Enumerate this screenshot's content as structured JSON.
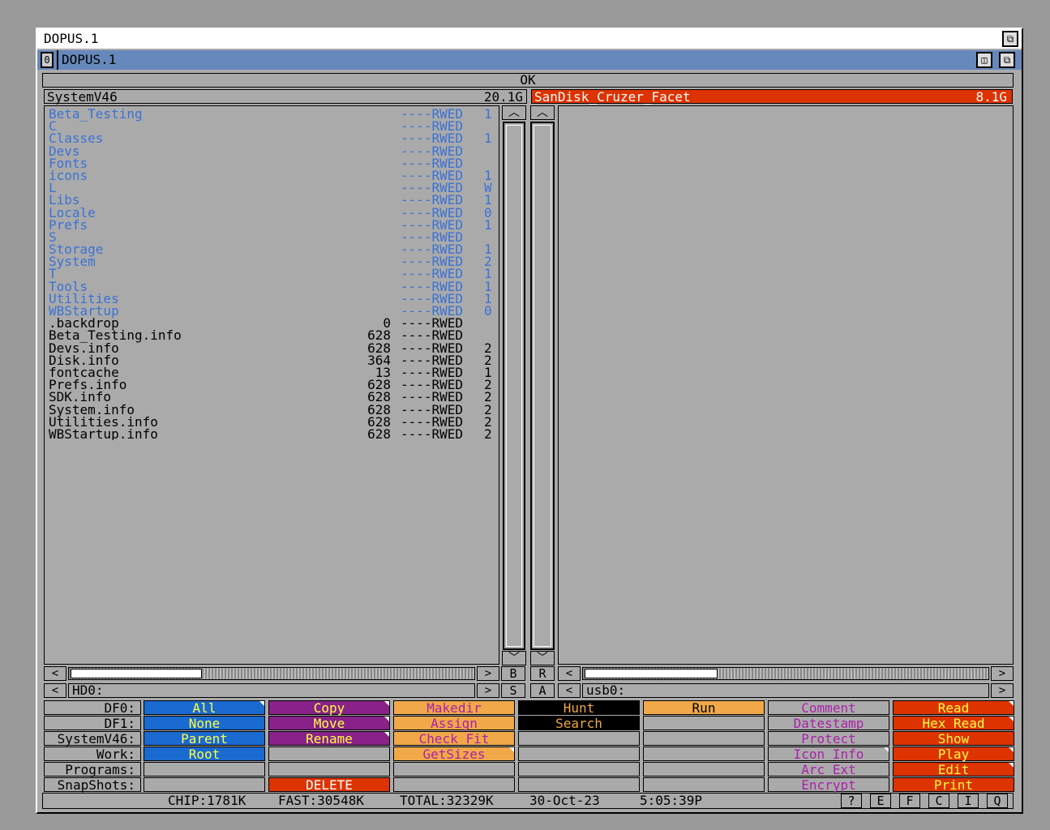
{
  "window": {
    "screen_title": "DOPUS.1",
    "title_index": "0",
    "title": "DOPUS.1"
  },
  "status_top": "OK",
  "left": {
    "name": "SystemV46",
    "free": "20.1G",
    "path": "HD0:",
    "entries": [
      {
        "name": "Beta_Testing",
        "size": "",
        "prot": "----RWED",
        "x": "1",
        "type": "dir"
      },
      {
        "name": "C",
        "size": "",
        "prot": "----RWED",
        "x": "",
        "type": "dir"
      },
      {
        "name": "Classes",
        "size": "",
        "prot": "----RWED",
        "x": "1",
        "type": "dir"
      },
      {
        "name": "Devs",
        "size": "",
        "prot": "----RWED",
        "x": "",
        "type": "dir"
      },
      {
        "name": "Fonts",
        "size": "",
        "prot": "----RWED",
        "x": "",
        "type": "dir"
      },
      {
        "name": "icons",
        "size": "",
        "prot": "----RWED",
        "x": "1",
        "type": "dir"
      },
      {
        "name": "L",
        "size": "",
        "prot": "----RWED",
        "x": "W",
        "type": "dir"
      },
      {
        "name": "Libs",
        "size": "",
        "prot": "----RWED",
        "x": "1",
        "type": "dir"
      },
      {
        "name": "Locale",
        "size": "",
        "prot": "----RWED",
        "x": "0",
        "type": "dir"
      },
      {
        "name": "Prefs",
        "size": "",
        "prot": "----RWED",
        "x": "1",
        "type": "dir"
      },
      {
        "name": "S",
        "size": "",
        "prot": "----RWED",
        "x": "",
        "type": "dir"
      },
      {
        "name": "Storage",
        "size": "",
        "prot": "----RWED",
        "x": "1",
        "type": "dir"
      },
      {
        "name": "System",
        "size": "",
        "prot": "----RWED",
        "x": "2",
        "type": "dir"
      },
      {
        "name": "T",
        "size": "",
        "prot": "----RWED",
        "x": "1",
        "type": "dir"
      },
      {
        "name": "Tools",
        "size": "",
        "prot": "----RWED",
        "x": "1",
        "type": "dir"
      },
      {
        "name": "Utilities",
        "size": "",
        "prot": "----RWED",
        "x": "1",
        "type": "dir"
      },
      {
        "name": "WBStartup",
        "size": "",
        "prot": "----RWED",
        "x": "0",
        "type": "dir"
      },
      {
        "name": ".backdrop",
        "size": "0",
        "prot": "----RWED",
        "x": "",
        "type": "file"
      },
      {
        "name": "Beta_Testing.info",
        "size": "628",
        "prot": "----RWED",
        "x": "",
        "type": "file"
      },
      {
        "name": "Devs.info",
        "size": "628",
        "prot": "----RWED",
        "x": "2",
        "type": "file"
      },
      {
        "name": "Disk.info",
        "size": "364",
        "prot": "----RWED",
        "x": "2",
        "type": "file"
      },
      {
        "name": "fontcache",
        "size": "13",
        "prot": "----RWED",
        "x": "1",
        "type": "file"
      },
      {
        "name": "Prefs.info",
        "size": "628",
        "prot": "----RWED",
        "x": "2",
        "type": "file"
      },
      {
        "name": "SDK.info",
        "size": "628",
        "prot": "----RWED",
        "x": "2",
        "type": "file"
      },
      {
        "name": "System.info",
        "size": "628",
        "prot": "----RWED",
        "x": "2",
        "type": "file"
      },
      {
        "name": "Utilities.info",
        "size": "628",
        "prot": "----RWED",
        "x": "2",
        "type": "file"
      },
      {
        "name": "WBStartup.info",
        "size": "628",
        "prot": "----RWED",
        "x": "2",
        "type": "file"
      }
    ]
  },
  "right": {
    "name": "SanDisk_Cruzer_Facet",
    "free": "8.1G",
    "path": "usb0:"
  },
  "mid_buttons": {
    "b": "B",
    "r": "R",
    "s": "S",
    "a": "A",
    "up": "^",
    "down": "v",
    "left": "<",
    "right": ">"
  },
  "bank": {
    "labels": [
      "DF0:",
      "DF1:",
      "SystemV46:",
      "Work:",
      "Programs:",
      "SnapShots:"
    ],
    "col1": [
      "All",
      "None",
      "Parent",
      "Root",
      "",
      ""
    ],
    "col2": [
      "Copy",
      "Move",
      "Rename",
      "",
      "",
      "DELETE"
    ],
    "col3": [
      "Makedir",
      "Assign",
      "Check Fit",
      "GetSizes",
      "",
      ""
    ],
    "col4": [
      "Hunt",
      "Search",
      "",
      "",
      "",
      ""
    ],
    "col5": [
      "Run",
      "",
      "",
      "",
      "",
      ""
    ],
    "col6": [
      "Comment",
      "Datestamp",
      "Protect",
      "Icon Info",
      "Arc Ext",
      "Encrypt"
    ],
    "col7": [
      "Read",
      "Hex Read",
      "Show",
      "Play",
      "Edit",
      "Print"
    ]
  },
  "status": {
    "chip": "CHIP:1781K",
    "fast": "FAST:30548K",
    "total": "TOTAL:32329K",
    "date": "30-Oct-23",
    "time": "5:05:39P",
    "buttons": [
      "?",
      "E",
      "F",
      "C",
      "I",
      "Q"
    ]
  },
  "colors": {
    "dir": "#3a72d6",
    "active_header": "#dd3300",
    "title_bar": "#6688bb"
  }
}
